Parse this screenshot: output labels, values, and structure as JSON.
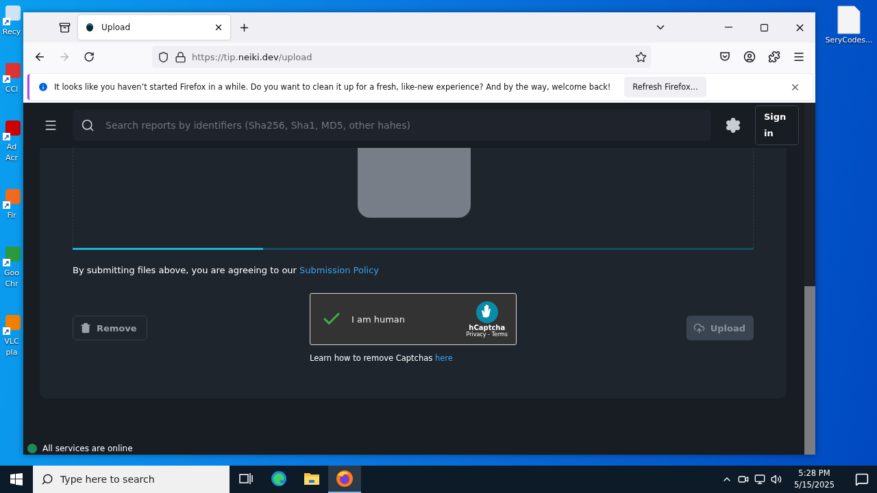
{
  "desktop": {
    "left_icons": [
      {
        "kind": "recycle",
        "lines": [
          "Recy"
        ]
      },
      {
        "kind": "ccleaner",
        "lines": [
          "CCl"
        ]
      },
      {
        "kind": "acrobat",
        "lines": [
          "Ad",
          "Acr"
        ]
      },
      {
        "kind": "firefox",
        "lines": [
          "Fir"
        ]
      },
      {
        "kind": "chrome",
        "lines": [
          "Goo",
          "Chr"
        ]
      },
      {
        "kind": "vlc",
        "lines": [
          "VLC",
          "pla"
        ]
      }
    ],
    "right_icons": [
      {
        "kind": "file",
        "lines": [
          "SeryCodes..."
        ]
      }
    ]
  },
  "browser": {
    "tabs": [
      {
        "title": "Upload",
        "selected": true
      }
    ],
    "nav_buttons": [
      {
        "kind": "back",
        "disabled": false
      },
      {
        "kind": "forward",
        "disabled": true
      },
      {
        "kind": "reload",
        "disabled": false
      }
    ],
    "url": {
      "start": "https://tip.",
      "domain": "neiki.dev",
      "path": "/upload"
    },
    "notification": {
      "message": "It looks like you haven’t started Firefox in a while. Do you want to clean it up for a fresh, like-new experience? And by the way, welcome back!",
      "button": "Refresh Firefox..."
    }
  },
  "page": {
    "search_placeholder": "Search reports by identifiers (Sha256, Sha1, MD5, other hahes)",
    "sign_in": "Sign in",
    "upload_progress": {
      "level": 0.28
    },
    "agreement": {
      "text": "By submitting files above, you are agreeing to our",
      "link": "Submission Policy"
    },
    "remove_button": "Remove",
    "captcha": {
      "checked": true,
      "label": "I am human",
      "brand": "hCaptcha",
      "links": "Privacy - Terms"
    },
    "upload_button": {
      "label": "Upload",
      "disabled": true
    },
    "captcha_help": {
      "text": "Learn how to remove Captchas",
      "link": "here"
    },
    "status": {
      "text": "All services are online"
    }
  },
  "taskbar": {
    "search_placeholder": "Type here to search",
    "apps": [
      {
        "kind": "task-view",
        "selected": false
      },
      {
        "kind": "edge",
        "selected": false
      },
      {
        "kind": "explorer",
        "selected": false
      },
      {
        "kind": "firefox",
        "selected": true
      }
    ],
    "time": "5:28 PM",
    "date": "5/15/2025"
  }
}
